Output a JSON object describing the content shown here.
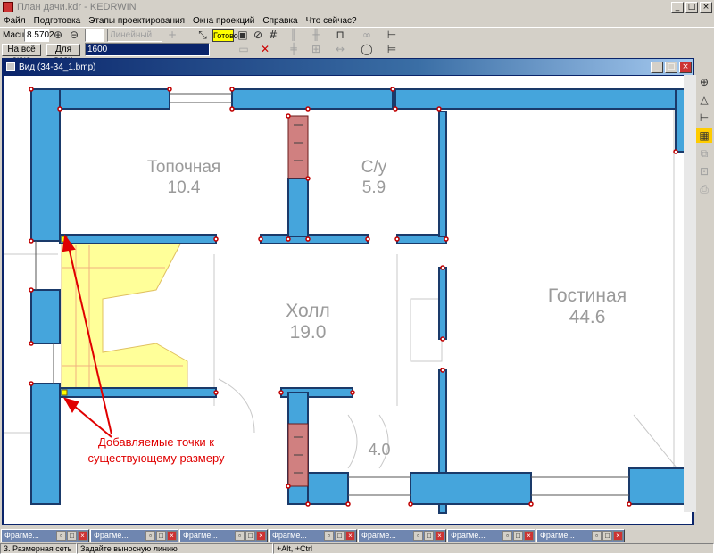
{
  "app": {
    "title": "План дачи.kdr - KEDRWIN",
    "menu": [
      "Файл",
      "Подготовка",
      "Этапы проектирования",
      "Окна проекций",
      "Справка",
      "Что сейчас?"
    ]
  },
  "toolbar": {
    "scale_label": "Масшт",
    "scale_value": "8.5702",
    "fit_window": "На всё окно",
    "for_all": "Для всех",
    "line_type": "Линейный",
    "value_field": "1600",
    "ready": "Готово",
    "icons": [
      "zoom-in-icon",
      "zoom-out-icon",
      "cursor-icon",
      "snap-icon",
      "grid-icon"
    ]
  },
  "view": {
    "title": "Вид (34-34_1.bmp)",
    "rooms": [
      {
        "name": "Топочная",
        "area": "10.4"
      },
      {
        "name": "С/у",
        "area": "5.9"
      },
      {
        "name": "Холл",
        "area": "19.0"
      },
      {
        "name": "Гостиная",
        "area": "44.6"
      },
      {
        "name": "",
        "area": "4.0"
      }
    ]
  },
  "annotation": {
    "text_line1": "Добавляемые точки к",
    "text_line2": "существующему размеру"
  },
  "taskbar": {
    "items": [
      "Фрагме...",
      "Фрагме...",
      "Фрагме...",
      "Фрагме...",
      "Фрагме...",
      "Фрагме...",
      "Фрагме..."
    ]
  },
  "status": {
    "mode": "3. Размерная сеть",
    "hint": "Задайте выносную линию",
    "keys": "+Alt, +Ctrl"
  }
}
